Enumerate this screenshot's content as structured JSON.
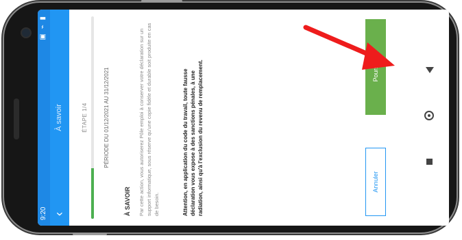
{
  "status_bar": {
    "time": "9:20",
    "icons": "▣ ⌁ ▮"
  },
  "header": {
    "title": "À savoir"
  },
  "step": {
    "label": "ÉTAPE 1/4",
    "progress_percent": 25
  },
  "period": {
    "text": "PÉRIODE DU 01/12/2021 AU 31/12/2021"
  },
  "section": {
    "heading": "À SAVOIR",
    "body": "Par cette action, vous autoriserez Pôle emploi à conserver votre déclaration sur un support informatique, sous réserve qu'une copie fidèle et durable soit produite en cas de besoin.",
    "warning": "Attention, en application du code du travail, toute fausse déclaration vous expose à des sanctions pénales, à une radiation, ainsi qu'à l'exclusion du revenu de remplacement."
  },
  "buttons": {
    "cancel_label": "Annuler",
    "continue_label": "Poursuivre"
  },
  "colors": {
    "appbar": "#2196f3",
    "progress": "#4caf50",
    "continue": "#6ab04c",
    "arrow": "#ee1c1c"
  },
  "nav": {
    "back_icon": "triangle-back-icon",
    "home_icon": "circle-home-icon",
    "recent_icon": "square-recent-icon"
  }
}
